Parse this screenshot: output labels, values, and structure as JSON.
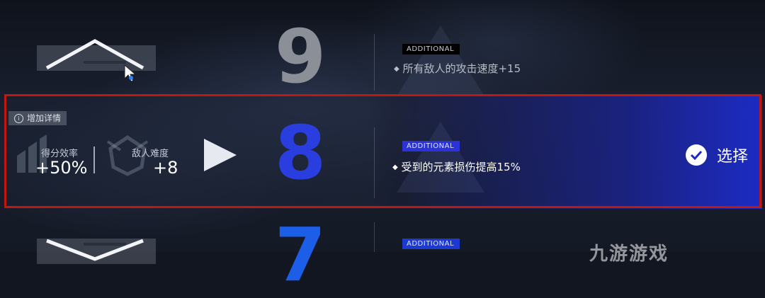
{
  "options": [
    {
      "level": "9",
      "tag": "ADDITIONAL",
      "effect": "所有敌人的攻击速度+15"
    },
    {
      "level": "8",
      "tag": "ADDITIONAL",
      "effect": "受到的元素损伤提高15%",
      "selected": true
    },
    {
      "level": "7",
      "tag": "ADDITIONAL"
    }
  ],
  "details": {
    "toggle_label": "增加详情",
    "score_label": "得分效率",
    "score_value": "+50%",
    "enemy_label": "敌人难度",
    "enemy_value": "+8"
  },
  "select_label": "选择",
  "watermark": "九游游戏",
  "colors": {
    "selected_level": "#2a3ee0",
    "highlight_border": "#c0180f",
    "unselected_level": "#8a8f98",
    "next_level": "#1c5ee8"
  }
}
